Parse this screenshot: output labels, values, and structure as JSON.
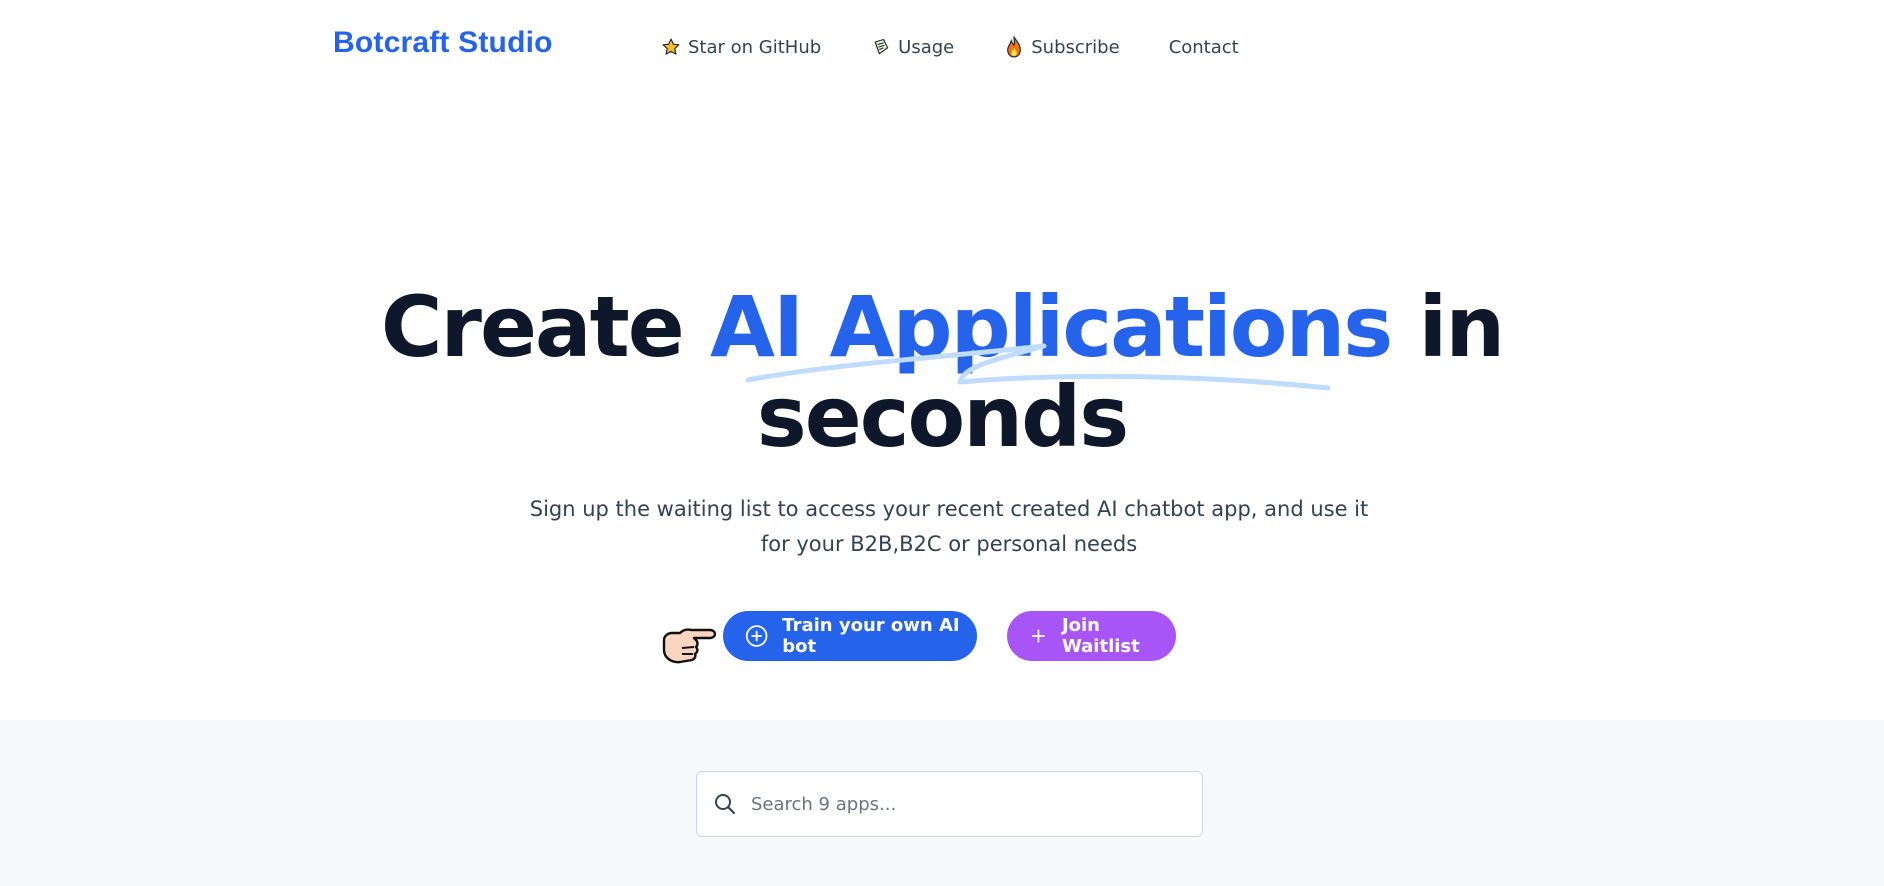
{
  "brand": "Botcraft Studio",
  "nav": [
    {
      "label": "Star on GitHub",
      "icon": "star-icon"
    },
    {
      "label": "Usage",
      "icon": "scroll-icon"
    },
    {
      "label": "Subscribe",
      "icon": "fire-icon"
    },
    {
      "label": "Contact",
      "icon": ""
    }
  ],
  "hero": {
    "title_start": "Create ",
    "title_accent": "AI Applications",
    "title_end": " in",
    "title_line2": "seconds",
    "subtitle": "Sign up the waiting list to access your recent created AI chatbot app, and use it for your B2B,B2C or personal needs"
  },
  "actions": {
    "primary_label": "Train your own AI bot",
    "secondary_label": "Join Waitlist"
  },
  "search": {
    "placeholder": "Search 9 apps..."
  },
  "colors": {
    "brand": "#2563eb",
    "accent_purple": "#a855f7",
    "heading": "#0f172a",
    "underline": "#bfdbfe"
  }
}
